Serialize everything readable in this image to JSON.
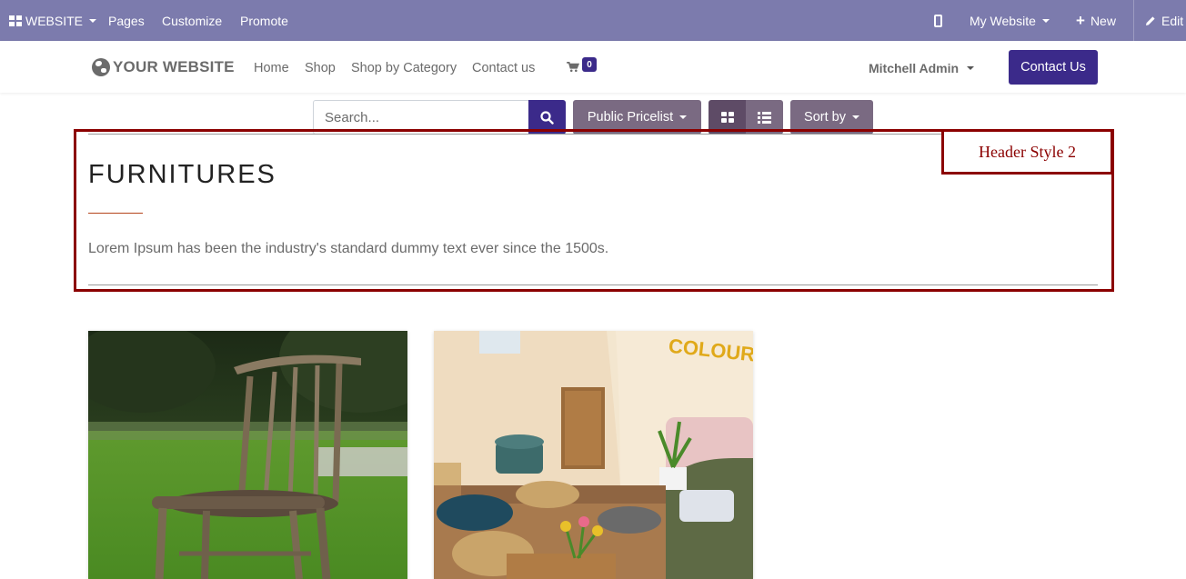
{
  "admin_bar": {
    "website_label": "WEBSITE",
    "pages_label": "Pages",
    "customize_label": "Customize",
    "promote_label": "Promote",
    "my_website_label": "My Website",
    "new_label": "New",
    "edit_label": "Edit"
  },
  "site_header": {
    "logo_text": "YOUR WEBSITE",
    "nav": [
      "Home",
      "Shop",
      "Shop by Category",
      "Contact us"
    ],
    "cart_count": "0",
    "user_name": "Mitchell Admin",
    "contact_button": "Contact Us"
  },
  "toolbar": {
    "search_placeholder": "Search...",
    "pricelist_label": "Public Pricelist",
    "sort_label": "Sort by"
  },
  "category": {
    "title": "FURNITURES",
    "description": "Lorem Ipsum has been the industry's standard dummy text ever since the 1500s.",
    "style_tag": "Header Style 2"
  },
  "products": [
    {
      "image": "wooden-chair-on-grass-photo"
    },
    {
      "image": "living-room-interior-photo",
      "balloon_text": "COLOURED"
    }
  ],
  "colors": {
    "admin_bar": "#7c7bad",
    "primary": "#3b2a8a",
    "secondary": "#7a6a82",
    "annotation": "#8b0000"
  }
}
